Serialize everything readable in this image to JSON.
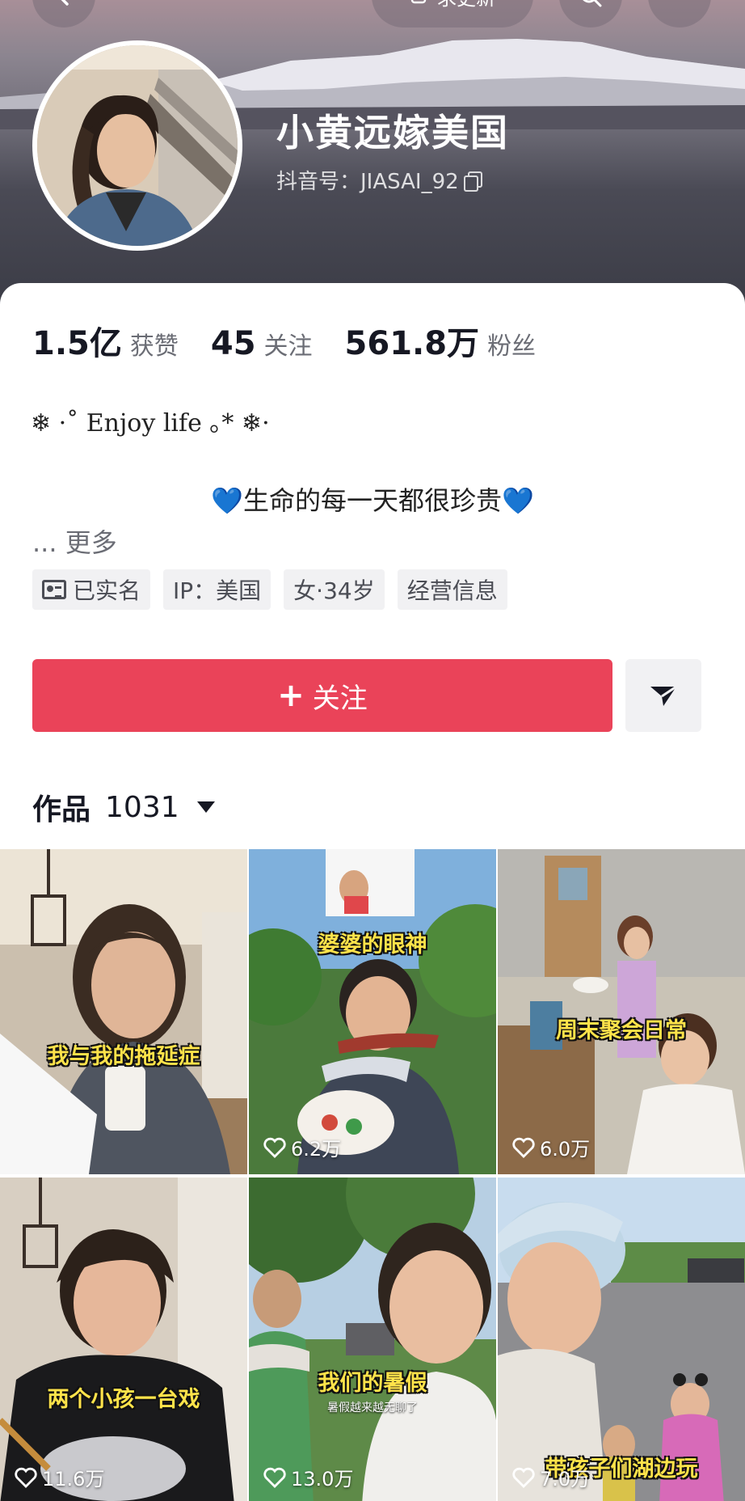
{
  "header": {
    "update_label": "求更新",
    "nickname": "小黄远嫁美国",
    "douyin_id": "抖音号：JIASAI_92"
  },
  "stats": [
    {
      "value": "1.5亿",
      "label": "获赞"
    },
    {
      "value": "45",
      "label": "关注"
    },
    {
      "value": "561.8万",
      "label": "粉丝"
    }
  ],
  "bio": {
    "line1": "❄ ·˚ Enjoy life ｡* ❄·",
    "line2": "💙生命的每一天都很珍贵💙",
    "more": "... 更多"
  },
  "tags": [
    "已实名",
    "IP：美国",
    "女·34岁",
    "经营信息"
  ],
  "actions": {
    "follow_label": "关注",
    "follow_plus": "+"
  },
  "works": {
    "label": "作品",
    "count": "1031"
  },
  "videos": [
    {
      "caption": "我与我的拖延症",
      "sub": "",
      "likes": ""
    },
    {
      "caption": "婆婆的眼神",
      "sub": "",
      "likes": "6.2万"
    },
    {
      "caption": "周末聚会日常",
      "sub": "",
      "likes": "6.0万"
    },
    {
      "caption": "两个小孩一台戏",
      "sub": "",
      "likes": "11.6万"
    },
    {
      "caption": "我们的暑假",
      "sub": "暑假越来越无聊了",
      "likes": "13.0万"
    },
    {
      "caption": "带孩子们湖边玩",
      "sub": "",
      "likes": "7.0万"
    }
  ],
  "colors": {
    "follow": "#ea4359",
    "caption": "#ffe34a"
  }
}
